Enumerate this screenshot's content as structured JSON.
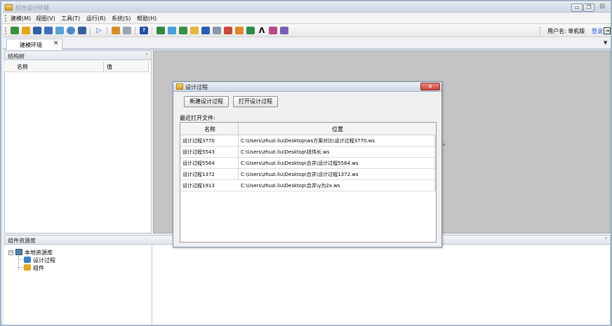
{
  "window": {
    "title": "综合设计环境",
    "controls": {
      "minimize": "▭",
      "restore": "❐",
      "close": "☒"
    }
  },
  "menu": [
    {
      "label": "建模(M)"
    },
    {
      "label": "视图(V)"
    },
    {
      "label": "工具(T)"
    },
    {
      "label": "运行(R)"
    },
    {
      "label": "系统(S)"
    },
    {
      "label": "帮助(H)"
    }
  ],
  "toolbar": {
    "icons": [
      "tree-icon",
      "upload-icon",
      "save-icon",
      "save-as-icon",
      "image-icon",
      "globe-icon",
      "grid-icon",
      "run-icon",
      "edit-icon",
      "zoom-icon",
      "help-icon",
      "excel-icon",
      "chart-icon",
      "table-icon",
      "folder-icon",
      "word-icon",
      "calculator-icon",
      "report-icon",
      "form-icon",
      "export-icon",
      "font-icon",
      "tools-icon",
      "picture-icon"
    ],
    "user_label": "用户名: 单机版",
    "login_label": "登录"
  },
  "tabs": [
    {
      "label": "建模环境",
      "close": "✕"
    }
  ],
  "structure_panel": {
    "title": "结构树",
    "pin": "ᵖ",
    "columns": [
      "名称",
      "值"
    ]
  },
  "background_trailing_text": "。",
  "component_panel": {
    "title": "组件资源库",
    "pin": "ᵖ",
    "tree": {
      "root": "本地资源库",
      "expander": "−",
      "children": [
        "设计过程",
        "组件"
      ]
    }
  },
  "dialog": {
    "title": "设计过程",
    "close": "✕",
    "buttons": {
      "new": "新建设计过程",
      "open": "打开设计过程"
    },
    "recent_label": "最近打开文件:",
    "table": {
      "columns": [
        "名称",
        "位置"
      ],
      "rows": [
        {
          "name": "设计过程3770",
          "path": "C:\\Users\\zhuzi.liu\\Desktop\\ws方案对比\\设计过程3770.ws"
        },
        {
          "name": "设计过程5543",
          "path": "C:\\Users\\zhuzi.liu\\Desktop\\钱伟长.ws"
        },
        {
          "name": "设计过程5564",
          "path": "C:\\Users\\zhuzi.liu\\Desktop\\合并\\设计过程5564.ws"
        },
        {
          "name": "设计过程1372",
          "path": "C:\\Users\\zhuzi.liu\\Desktop\\合并\\设计过程1372.ws"
        },
        {
          "name": "设计过程1913",
          "path": "C:\\Users\\zhuzi.liu\\Desktop\\合并\\y为2x.ws"
        }
      ]
    }
  }
}
